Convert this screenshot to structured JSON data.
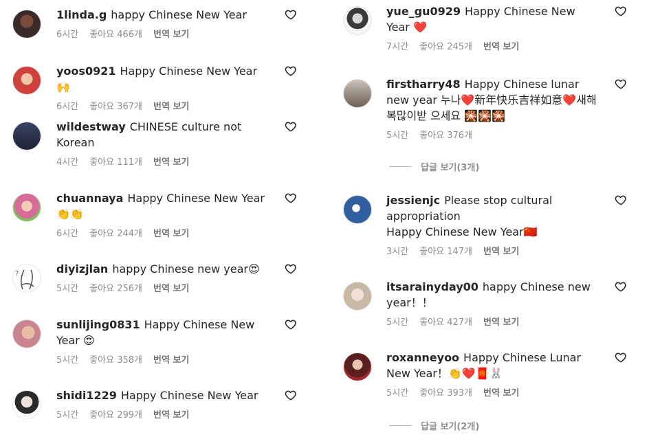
{
  "colors": {
    "text": "#262626",
    "meta": "#8e8e8e",
    "heart_emoji": "#e0242f"
  },
  "left": [
    {
      "username": "1linda.g",
      "text": "happy Chinese New Year",
      "time": "6시간",
      "likes": "좋아요 466개",
      "translate": "번역 보기",
      "avatar": "avatar-1linda"
    },
    {
      "username": "yoos0921",
      "text": "Happy Chinese New Year🙌",
      "time": "6시간",
      "likes": "좋아요 367개",
      "translate": "번역 보기",
      "avatar": "avatar-yoos"
    },
    {
      "username": "wildestway",
      "text": "CHINESE culture not Korean",
      "time": "4시간",
      "likes": "좋아요 111개",
      "translate": "번역 보기",
      "avatar": "avatar-wildestway"
    },
    {
      "username": "chuannaya",
      "text": "Happy Chinese New Year 👏👏",
      "time": "6시간",
      "likes": "좋아요 244개",
      "translate": "번역 보기",
      "avatar": "avatar-chuannaya"
    },
    {
      "username": "diyizjlan",
      "text": "happy Chinese new year😍",
      "time": "5시간",
      "likes": "좋아요 256개",
      "translate": "번역 보기",
      "avatar": "avatar-diyizjlan"
    },
    {
      "username": "sunlijing0831",
      "text": "Happy Chinese New Year 😍",
      "time": "5시간",
      "likes": "좋아요 358개",
      "translate": "번역 보기",
      "avatar": "avatar-sunlijing"
    },
    {
      "username": "shidi1229",
      "text": "Happy Chinese New Year",
      "time": "5시간",
      "likes": "좋아요 299개",
      "translate": "번역 보기",
      "avatar": "avatar-shidi"
    }
  ],
  "right": [
    {
      "username": "yue_gu0929",
      "text": "Happy Chinese New Year ❤️",
      "time": "7시간",
      "likes": "좋아요 245개",
      "translate": "번역 보기",
      "avatar": "avatar-yue"
    },
    {
      "username": "firstharry48",
      "text": "Happy Chinese lunar new year 누나❤️新年快乐吉祥如意❤️새해 복많이받 으세요 🎇🎇🎇",
      "time": "5시간",
      "likes": "좋아요 376개",
      "translate": "",
      "avatar": "avatar-firstharry",
      "replies": "답글 보기(3개)"
    },
    {
      "username": "jessienjc",
      "text": "Please stop cultural appropriation\nHappy Chinese New Year🇨🇳",
      "time": "3시간",
      "likes": "좋아요 147개",
      "translate": "번역 보기",
      "avatar": "avatar-jessienjc"
    },
    {
      "username": "itsarainyday00",
      "text": "happy Chinese new year！！",
      "time": "5시간",
      "likes": "좋아요 427개",
      "translate": "번역 보기",
      "avatar": "avatar-itsarainyday"
    },
    {
      "username": "roxanneyoo",
      "text": "Happy Chinese Lunar New Year！👏❤️🧧🐰",
      "time": "5시간",
      "likes": "좋아요 393개",
      "translate": "번역 보기",
      "avatar": "avatar-roxanneyoo",
      "replies": "답글 보기(2개)"
    }
  ]
}
